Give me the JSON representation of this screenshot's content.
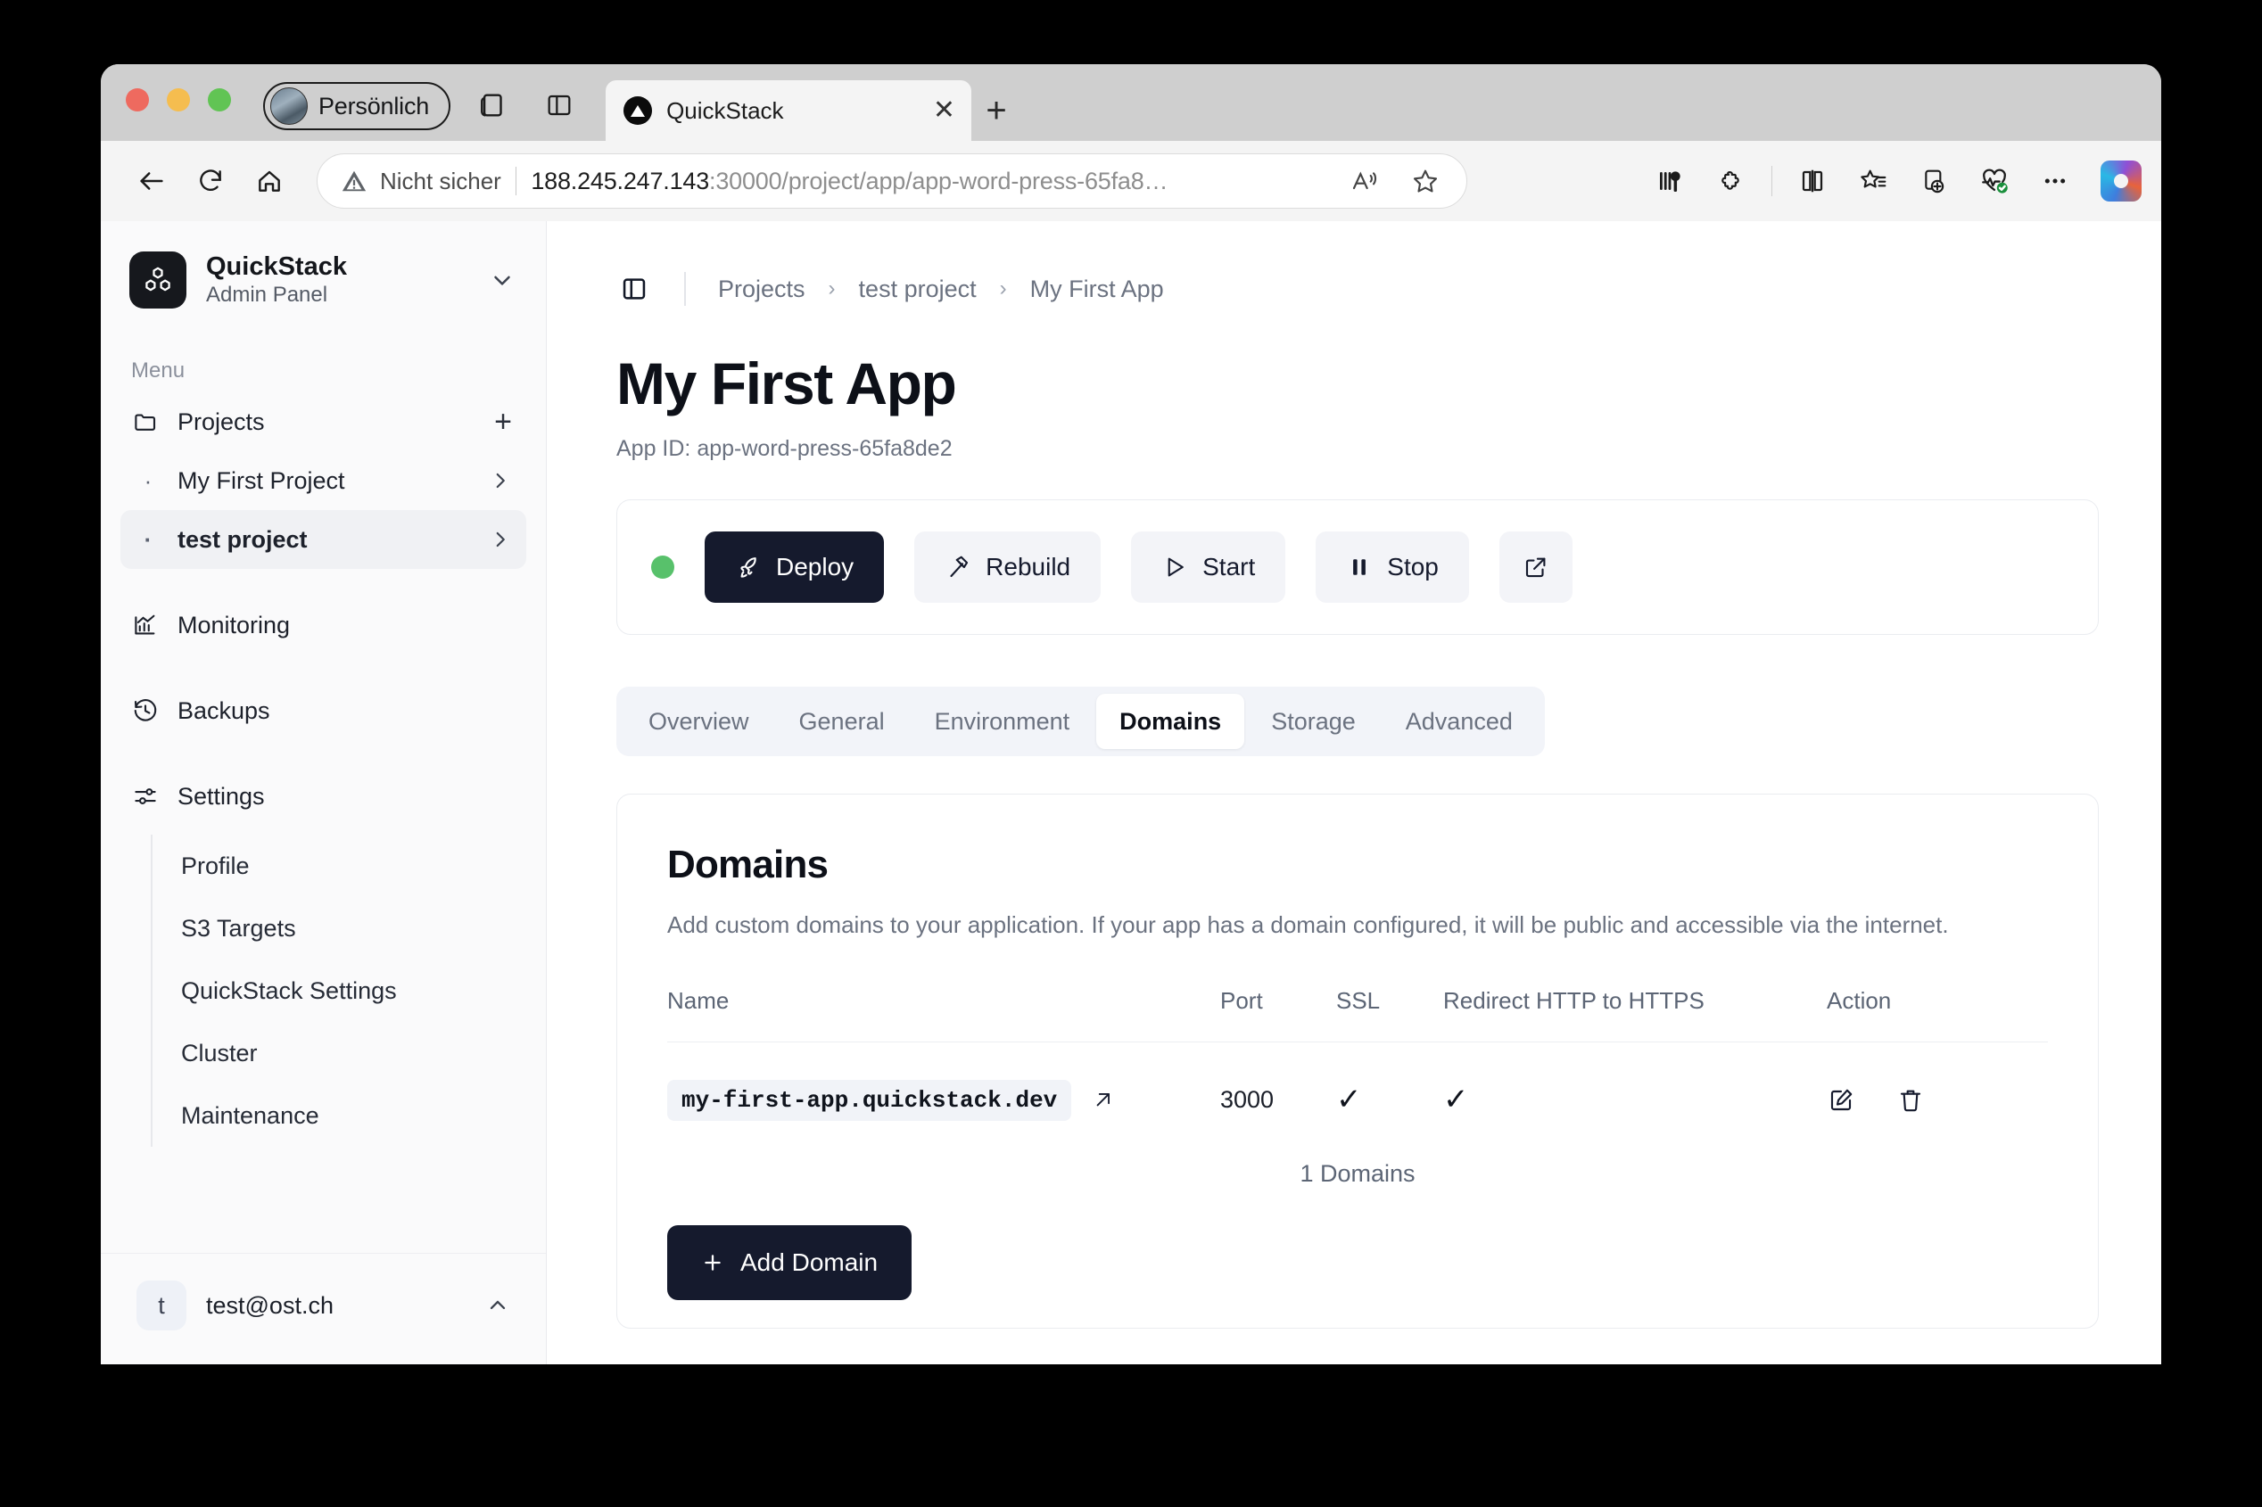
{
  "browser": {
    "profile_name": "Persönlich",
    "tab_title": "QuickStack",
    "security_label": "Nicht sicher",
    "url_host": "188.245.247.143",
    "url_rest": ":30000/project/app/app-word-press-65fa8…",
    "url_full": "188.245.247.143:30000/project/app/app-word-press-65fa8…"
  },
  "sidebar": {
    "brand_title": "QuickStack",
    "brand_subtitle": "Admin Panel",
    "menu_label": "Menu",
    "projects_label": "Projects",
    "projects": [
      {
        "label": "My First Project",
        "active": false
      },
      {
        "label": "test project",
        "active": true
      }
    ],
    "items": [
      {
        "label": "Monitoring"
      },
      {
        "label": "Backups"
      },
      {
        "label": "Settings"
      }
    ],
    "settings_children": [
      {
        "label": "Profile"
      },
      {
        "label": "S3 Targets"
      },
      {
        "label": "QuickStack Settings"
      },
      {
        "label": "Cluster"
      },
      {
        "label": "Maintenance"
      }
    ],
    "user": {
      "initial": "t",
      "email": "test@ost.ch"
    }
  },
  "breadcrumb": {
    "items": [
      "Projects",
      "test project",
      "My First App"
    ],
    "separator": "›"
  },
  "page": {
    "title": "My First App",
    "app_id_label": "App ID: app-word-press-65fa8de2"
  },
  "actions": {
    "status_color": "#58c16b",
    "buttons": [
      {
        "label": "Deploy",
        "icon": "rocket-icon",
        "primary": true
      },
      {
        "label": "Rebuild",
        "icon": "hammer-icon",
        "primary": false
      },
      {
        "label": "Start",
        "icon": "play-icon",
        "primary": false
      },
      {
        "label": "Stop",
        "icon": "pause-icon",
        "primary": false
      },
      {
        "label": "",
        "icon": "external-link-icon",
        "primary": false
      }
    ]
  },
  "tabs": [
    {
      "label": "Overview",
      "active": false
    },
    {
      "label": "General",
      "active": false
    },
    {
      "label": "Environment",
      "active": false
    },
    {
      "label": "Domains",
      "active": true
    },
    {
      "label": "Storage",
      "active": false
    },
    {
      "label": "Advanced",
      "active": false
    }
  ],
  "domains_panel": {
    "title": "Domains",
    "description": "Add custom domains to your application. If your app has a domain configured, it will be public and accessible via the internet.",
    "columns": [
      "Name",
      "Port",
      "SSL",
      "Redirect HTTP to HTTPS",
      "Action"
    ],
    "rows": [
      {
        "name": "my-first-app.quickstack.dev",
        "port": "3000",
        "ssl": "✓",
        "redirect": "✓"
      }
    ],
    "count_label": "1 Domains",
    "add_button_label": "Add Domain"
  },
  "colors": {
    "primary_dark": "#151a2d",
    "status_green": "#58c16b",
    "muted_text": "#6b7280",
    "panel_bg": "#f2f4f9"
  }
}
